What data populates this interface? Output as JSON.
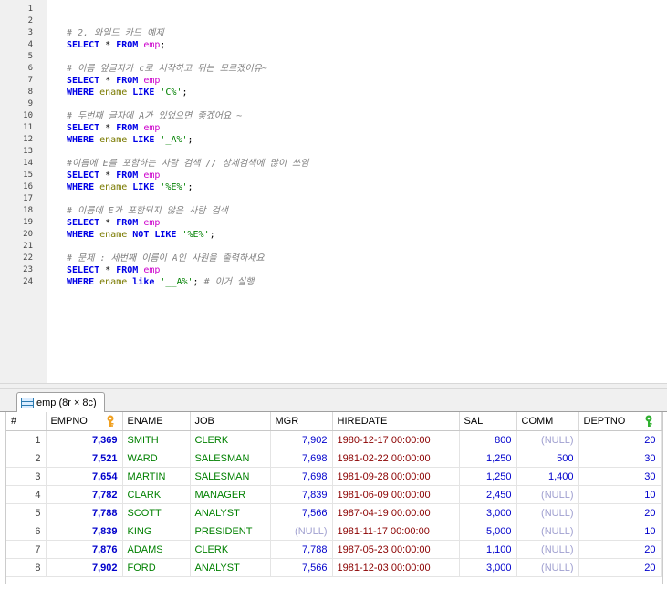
{
  "editor": {
    "line_numbers": [
      "1",
      "2",
      "3",
      "4",
      "5",
      "6",
      "7",
      "8",
      "9",
      "10",
      "11",
      "12",
      "13",
      "14",
      "15",
      "16",
      "17",
      "18",
      "19",
      "20",
      "21",
      "22",
      "23",
      "24"
    ],
    "lines": [
      [],
      [],
      [
        {
          "t": "cm",
          "v": "# 2. 와일드 카드 예제"
        }
      ],
      [
        {
          "t": "kw",
          "v": "SELECT"
        },
        {
          "t": "plain",
          "v": " * "
        },
        {
          "t": "kw",
          "v": "FROM"
        },
        {
          "t": "plain",
          "v": " "
        },
        {
          "t": "tbl",
          "v": "emp"
        },
        {
          "t": "plain",
          "v": ";"
        }
      ],
      [],
      [
        {
          "t": "cm",
          "v": "# 이름 앞글자가 c로 시작하고 뒤는 모르겠어유~"
        }
      ],
      [
        {
          "t": "kw",
          "v": "SELECT"
        },
        {
          "t": "plain",
          "v": " * "
        },
        {
          "t": "kw",
          "v": "FROM"
        },
        {
          "t": "plain",
          "v": " "
        },
        {
          "t": "tbl",
          "v": "emp"
        }
      ],
      [
        {
          "t": "kw",
          "v": "WHERE"
        },
        {
          "t": "plain",
          "v": " "
        },
        {
          "t": "col",
          "v": "ename"
        },
        {
          "t": "plain",
          "v": " "
        },
        {
          "t": "kw",
          "v": "LIKE"
        },
        {
          "t": "plain",
          "v": " "
        },
        {
          "t": "str",
          "v": "'C%'"
        },
        {
          "t": "plain",
          "v": ";"
        }
      ],
      [],
      [
        {
          "t": "cm",
          "v": "# 두번째 글자에 A가 있었으면 좋겠어요 ~"
        }
      ],
      [
        {
          "t": "kw",
          "v": "SELECT"
        },
        {
          "t": "plain",
          "v": " * "
        },
        {
          "t": "kw",
          "v": "FROM"
        },
        {
          "t": "plain",
          "v": " "
        },
        {
          "t": "tbl",
          "v": "emp"
        }
      ],
      [
        {
          "t": "kw",
          "v": "WHERE"
        },
        {
          "t": "plain",
          "v": " "
        },
        {
          "t": "col",
          "v": "ename"
        },
        {
          "t": "plain",
          "v": " "
        },
        {
          "t": "kw",
          "v": "LIKE"
        },
        {
          "t": "plain",
          "v": " "
        },
        {
          "t": "str",
          "v": "'_A%'"
        },
        {
          "t": "plain",
          "v": ";"
        }
      ],
      [],
      [
        {
          "t": "cm",
          "v": "#이름에 E를 포함하는 사람 검색 // 상세검색에 많이 쓰임"
        }
      ],
      [
        {
          "t": "kw",
          "v": "SELECT"
        },
        {
          "t": "plain",
          "v": " * "
        },
        {
          "t": "kw",
          "v": "FROM"
        },
        {
          "t": "plain",
          "v": " "
        },
        {
          "t": "tbl",
          "v": "emp"
        }
      ],
      [
        {
          "t": "kw",
          "v": "WHERE"
        },
        {
          "t": "plain",
          "v": " "
        },
        {
          "t": "col",
          "v": "ename"
        },
        {
          "t": "plain",
          "v": " "
        },
        {
          "t": "kw",
          "v": "LIKE"
        },
        {
          "t": "plain",
          "v": " "
        },
        {
          "t": "str",
          "v": "'%E%'"
        },
        {
          "t": "plain",
          "v": ";"
        }
      ],
      [],
      [
        {
          "t": "cm",
          "v": "# 이름에 E가 포함되지 않은 사람 검색"
        }
      ],
      [
        {
          "t": "kw",
          "v": "SELECT"
        },
        {
          "t": "plain",
          "v": " * "
        },
        {
          "t": "kw",
          "v": "FROM"
        },
        {
          "t": "plain",
          "v": " "
        },
        {
          "t": "tbl",
          "v": "emp"
        }
      ],
      [
        {
          "t": "kw",
          "v": "WHERE"
        },
        {
          "t": "plain",
          "v": " "
        },
        {
          "t": "col",
          "v": "ename"
        },
        {
          "t": "plain",
          "v": " "
        },
        {
          "t": "kw",
          "v": "NOT"
        },
        {
          "t": "plain",
          "v": " "
        },
        {
          "t": "kw",
          "v": "LIKE"
        },
        {
          "t": "plain",
          "v": " "
        },
        {
          "t": "str",
          "v": "'%E%'"
        },
        {
          "t": "plain",
          "v": ";"
        }
      ],
      [],
      [
        {
          "t": "cm",
          "v": "# 문제 : 세번째 이름이 A인 사원을 출력하세요"
        }
      ],
      [
        {
          "t": "kw",
          "v": "SELECT"
        },
        {
          "t": "plain",
          "v": " * "
        },
        {
          "t": "kw",
          "v": "FROM"
        },
        {
          "t": "plain",
          "v": " "
        },
        {
          "t": "tbl",
          "v": "emp"
        }
      ],
      [
        {
          "t": "kw",
          "v": "WHERE"
        },
        {
          "t": "plain",
          "v": " "
        },
        {
          "t": "col",
          "v": "ename"
        },
        {
          "t": "plain",
          "v": " "
        },
        {
          "t": "kw",
          "v": "like"
        },
        {
          "t": "plain",
          "v": " "
        },
        {
          "t": "str",
          "v": "'__A%'"
        },
        {
          "t": "plain",
          "v": "; "
        },
        {
          "t": "cm",
          "v": "# 이거 실행"
        }
      ]
    ]
  },
  "result_tab": {
    "label": "emp (8r × 8c)",
    "icon": "table-grid-icon"
  },
  "grid": {
    "columns": [
      {
        "label": "#",
        "key": "idx"
      },
      {
        "label": "EMPNO",
        "key": "empno",
        "icon": "primary-key-icon"
      },
      {
        "label": "ENAME",
        "key": "ename"
      },
      {
        "label": "JOB",
        "key": "job"
      },
      {
        "label": "MGR",
        "key": "mgr"
      },
      {
        "label": "HIREDATE",
        "key": "hiredate"
      },
      {
        "label": "SAL",
        "key": "sal"
      },
      {
        "label": "COMM",
        "key": "comm"
      },
      {
        "label": "DEPTNO",
        "key": "deptno",
        "icon": "foreign-key-icon"
      }
    ],
    "rows": [
      {
        "idx": "1",
        "empno": "7,369",
        "ename": "SMITH",
        "job": "CLERK",
        "mgr": "7,902",
        "hiredate": "1980-12-17 00:00:00",
        "sal": "800",
        "comm": "(NULL)",
        "deptno": "20"
      },
      {
        "idx": "2",
        "empno": "7,521",
        "ename": "WARD",
        "job": "SALESMAN",
        "mgr": "7,698",
        "hiredate": "1981-02-22 00:00:00",
        "sal": "1,250",
        "comm": "500",
        "deptno": "30"
      },
      {
        "idx": "3",
        "empno": "7,654",
        "ename": "MARTIN",
        "job": "SALESMAN",
        "mgr": "7,698",
        "hiredate": "1981-09-28 00:00:00",
        "sal": "1,250",
        "comm": "1,400",
        "deptno": "30"
      },
      {
        "idx": "4",
        "empno": "7,782",
        "ename": "CLARK",
        "job": "MANAGER",
        "mgr": "7,839",
        "hiredate": "1981-06-09 00:00:00",
        "sal": "2,450",
        "comm": "(NULL)",
        "deptno": "10"
      },
      {
        "idx": "5",
        "empno": "7,788",
        "ename": "SCOTT",
        "job": "ANALYST",
        "mgr": "7,566",
        "hiredate": "1987-04-19 00:00:00",
        "sal": "3,000",
        "comm": "(NULL)",
        "deptno": "20"
      },
      {
        "idx": "6",
        "empno": "7,839",
        "ename": "KING",
        "job": "PRESIDENT",
        "mgr": "(NULL)",
        "hiredate": "1981-11-17 00:00:00",
        "sal": "5,000",
        "comm": "(NULL)",
        "deptno": "10"
      },
      {
        "idx": "7",
        "empno": "7,876",
        "ename": "ADAMS",
        "job": "CLERK",
        "mgr": "7,788",
        "hiredate": "1987-05-23 00:00:00",
        "sal": "1,100",
        "comm": "(NULL)",
        "deptno": "20"
      },
      {
        "idx": "8",
        "empno": "7,902",
        "ename": "FORD",
        "job": "ANALYST",
        "mgr": "7,566",
        "hiredate": "1981-12-03 00:00:00",
        "sal": "3,000",
        "comm": "(NULL)",
        "deptno": "20"
      }
    ]
  },
  "colors": {
    "keyword": "#0000e6",
    "table": "#cc00cc",
    "column": "#7a7a00",
    "string": "#008000",
    "comment": "#808080",
    "number": "#0000cc",
    "text": "#008000",
    "date": "#8b0000",
    "null": "#a0a0d0",
    "pk_key": "#f0a020",
    "fk_key": "#30b030"
  }
}
